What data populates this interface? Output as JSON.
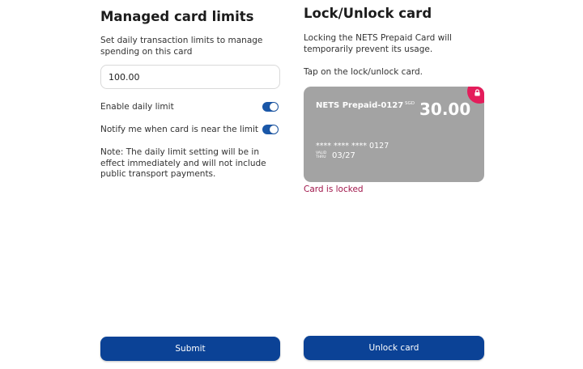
{
  "limits": {
    "title": "Managed card limits",
    "description": "Set daily transaction limits to manage spending on this card",
    "limit_value": "100.00",
    "enable_daily_limit": {
      "label": "Enable daily limit",
      "state": "on"
    },
    "notify_near_limit": {
      "label": "Notify me when card is near the limit",
      "state": "on"
    },
    "note": "Note: The daily limit setting will be in effect immediately and will not include public transport payments.",
    "submit_label": "Submit"
  },
  "lock": {
    "title": "Lock/Unlock card",
    "description": "Locking the NETS Prepaid Card will temporarily prevent its usage.",
    "instruction": "Tap on the lock/unlock card.",
    "card": {
      "name": "NETS Prepaid-0127",
      "currency": "SGD",
      "balance": "30.00",
      "masked_number": "**** **** **** 0127",
      "valid_thru_label": "VALID THRU",
      "expiry": "03/27",
      "background_color": "#a3a3a3",
      "lock_badge_color": "#e41d5b",
      "lock_icon": "lock-icon"
    },
    "status": "Card is locked",
    "status_color": "#a0154a",
    "unlock_label": "Unlock card"
  },
  "colors": {
    "primary_button": "#0b4296",
    "toggle_on": "#1a57a8"
  }
}
